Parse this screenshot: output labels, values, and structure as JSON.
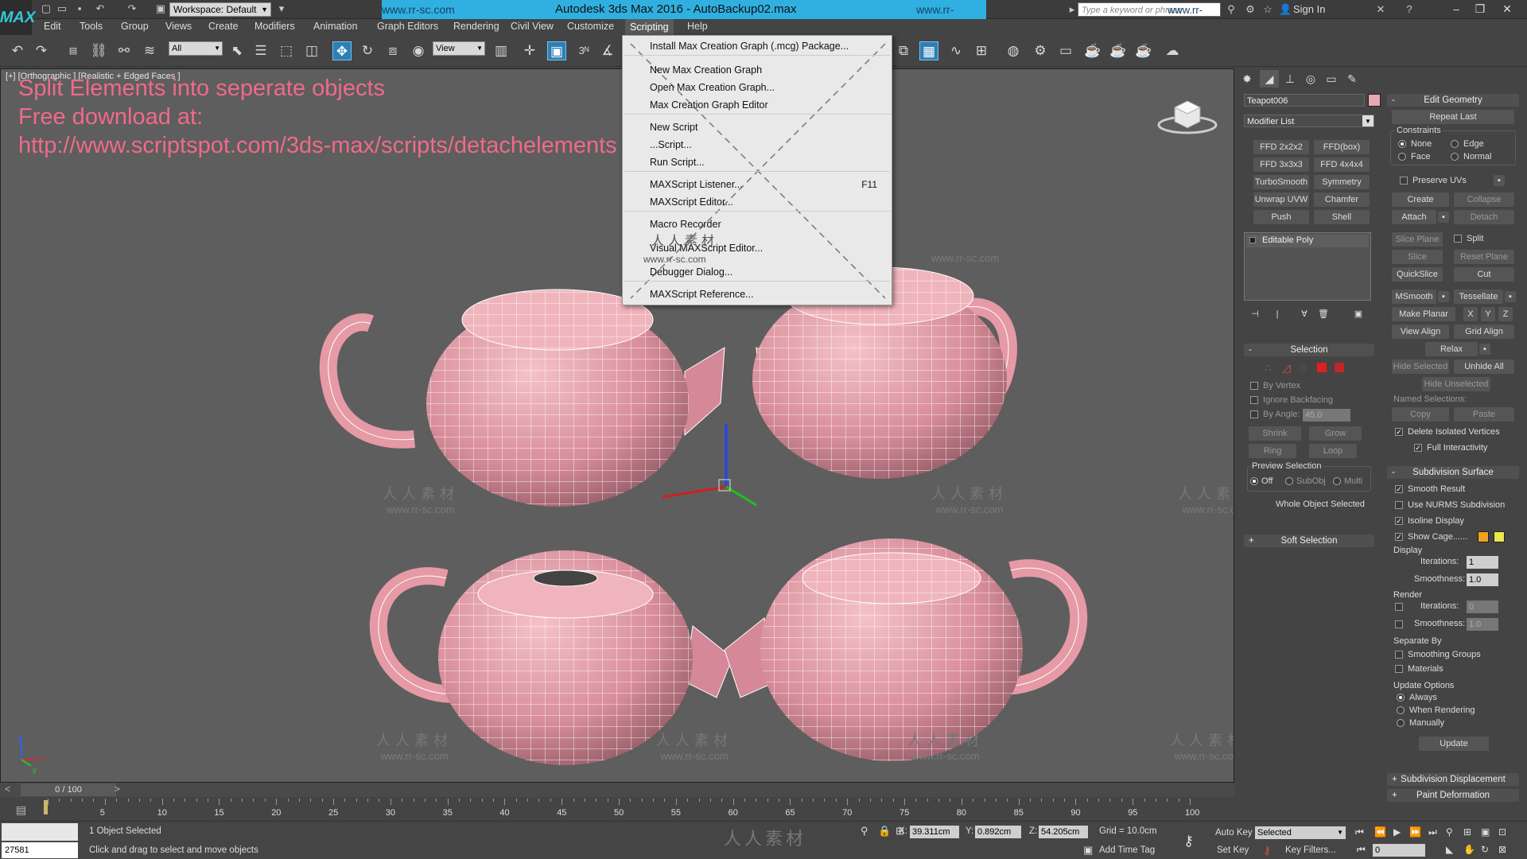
{
  "titlebar": {
    "logo": "MAX",
    "workspace": "Workspace: Default",
    "title": "Autodesk 3ds Max 2016 - AutoBackup02.max",
    "watermark_left": "www.rr-sc.com",
    "watermark_right": "www.rr-sc.com",
    "search_placeholder": "Type a keyword or phrase",
    "search_watermark": "www.rr-sc.com",
    "sign_in": "Sign In"
  },
  "menubar": [
    "Edit",
    "Tools",
    "Group",
    "Views",
    "Create",
    "Modifiers",
    "Animation",
    "Graph Editors",
    "Rendering",
    "Civil View",
    "Customize",
    "Scripting",
    "Help"
  ],
  "toolbar": {
    "selection_filter": "All",
    "ref_coord": "View",
    "snap_label": "3",
    "named_sel": "",
    "cursor_watermark": "www.rr-sc.com"
  },
  "viewport": {
    "label": "[+] [Orthographic ] [Realistic + Edged Faces ]",
    "overlay_lines": [
      "Split Elements into seperate objects",
      "Free download at:",
      "http://www.scriptspot.com/3ds-max/scripts/detachelements"
    ],
    "watermark_cn": "人人素材",
    "watermark_url": "www.rr-sc.com",
    "axis_labels": [
      "x",
      "y",
      "z"
    ]
  },
  "dropdown": {
    "items": [
      {
        "label": "Install Max Creation Graph (.mcg) Package...",
        "shortcut": ""
      },
      {
        "label": "New Max Creation Graph",
        "shortcut": ""
      },
      {
        "label": "Open Max Creation Graph...",
        "shortcut": ""
      },
      {
        "label": "Max Creation Graph Editor",
        "shortcut": ""
      },
      {
        "label": "New Script",
        "shortcut": ""
      },
      {
        "label": "...Script...",
        "shortcut": ""
      },
      {
        "label": "Run Script...",
        "shortcut": ""
      },
      {
        "label": "MAXScript Listener...",
        "shortcut": "F11"
      },
      {
        "label": "MAXScript Editor...",
        "shortcut": ""
      },
      {
        "label": "Macro Recorder",
        "shortcut": ""
      },
      {
        "label": "Visual MAXScript Editor...",
        "shortcut": ""
      },
      {
        "label": "Debugger Dialog...",
        "shortcut": ""
      },
      {
        "label": "MAXScript Reference...",
        "shortcut": ""
      }
    ],
    "wm_cn": "人人素材",
    "wm_url": "www.rr-sc.com"
  },
  "modify_panel": {
    "object_name": "Teapot006",
    "object_color": "#e8a8b4",
    "modifier_list": "Modifier List",
    "modifier_buttons": [
      "FFD 2x2x2",
      "FFD(box)",
      "FFD 3x3x3",
      "FFD 4x4x4",
      "TurboSmooth",
      "Symmetry",
      "Unwrap UVW",
      "Chamfer",
      "Push",
      "Shell"
    ],
    "stack_item": "Editable Poly",
    "selection": {
      "title": "Selection",
      "by_vertex": "By Vertex",
      "ignore_backfacing": "Ignore Backfacing",
      "by_angle": "By Angle:",
      "angle_value": "45.0",
      "shrink": "Shrink",
      "grow": "Grow",
      "ring": "Ring",
      "loop": "Loop",
      "preview_title": "Preview Selection",
      "preview_off": "Off",
      "preview_subobj": "SubObj",
      "preview_multi": "Multi",
      "whole_object": "Whole Object Selected"
    },
    "soft_selection": "Soft Selection"
  },
  "edit_geometry": {
    "title": "Edit Geometry",
    "repeat_last": "Repeat Last",
    "constraints": "Constraints",
    "none": "None",
    "edge": "Edge",
    "face": "Face",
    "normal": "Normal",
    "preserve_uvs": "Preserve UVs",
    "create": "Create",
    "collapse": "Collapse",
    "attach": "Attach",
    "detach": "Detach",
    "slice_plane": "Slice Plane",
    "split": "Split",
    "slice": "Slice",
    "reset_plane": "Reset Plane",
    "quickslice": "QuickSlice",
    "cut": "Cut",
    "msmooth": "MSmooth",
    "tessellate": "Tessellate",
    "make_planar": "Make Planar",
    "x": "X",
    "y": "Y",
    "z": "Z",
    "view_align": "View Align",
    "grid_align": "Grid Align",
    "relax": "Relax",
    "hide_selected": "Hide Selected",
    "unhide_all": "Unhide All",
    "hide_unselected": "Hide Unselected",
    "named_selections": "Named Selections:",
    "copy": "Copy",
    "paste": "Paste",
    "delete_isolated": "Delete Isolated Vertices",
    "full_interactivity": "Full Interactivity"
  },
  "subdivision": {
    "title": "Subdivision Surface",
    "smooth_result": "Smooth Result",
    "use_nurms": "Use NURMS Subdivision",
    "isoline": "Isoline Display",
    "show_cage": "Show Cage......",
    "cage_color_1": "#f0a020",
    "cage_color_2": "#e8e850",
    "display": "Display",
    "iterations": "Iterations:",
    "iterations_value": "1",
    "smoothness": "Smoothness:",
    "smoothness_value": "1.0",
    "render": "Render",
    "r_iterations_value": "0",
    "r_smoothness_value": "1.0",
    "separate_by": "Separate By",
    "smoothing_groups": "Smoothing Groups",
    "materials": "Materials",
    "update_options": "Update Options",
    "always": "Always",
    "when_rendering": "When Rendering",
    "manually": "Manually",
    "update": "Update",
    "subdivision_displacement": "Subdivision Displacement",
    "paint_deformation": "Paint Deformation"
  },
  "timeline": {
    "frame": "0 / 100",
    "ticks": [
      "5",
      "10",
      "15",
      "20",
      "25",
      "30",
      "35",
      "40",
      "45",
      "50",
      "55",
      "60",
      "65",
      "70",
      "75",
      "80",
      "85",
      "90",
      "95",
      "100"
    ]
  },
  "status": {
    "listener_value": "27581",
    "objects_selected": "1 Object Selected",
    "prompt": "Click and drag to select and move objects",
    "x_label": "X:",
    "x_value": "39.311cm",
    "y_label": "Y:",
    "y_value": "0.892cm",
    "z_label": "Z:",
    "z_value": "54.205cm",
    "grid": "Grid = 10.0cm",
    "add_time_tag": "Add Time Tag",
    "auto_key": "Auto Key",
    "set_key": "Set Key",
    "selected_combo": "Selected",
    "key_filters": "Key Filters...",
    "frame_value": "0",
    "watermark": "人人素材"
  }
}
